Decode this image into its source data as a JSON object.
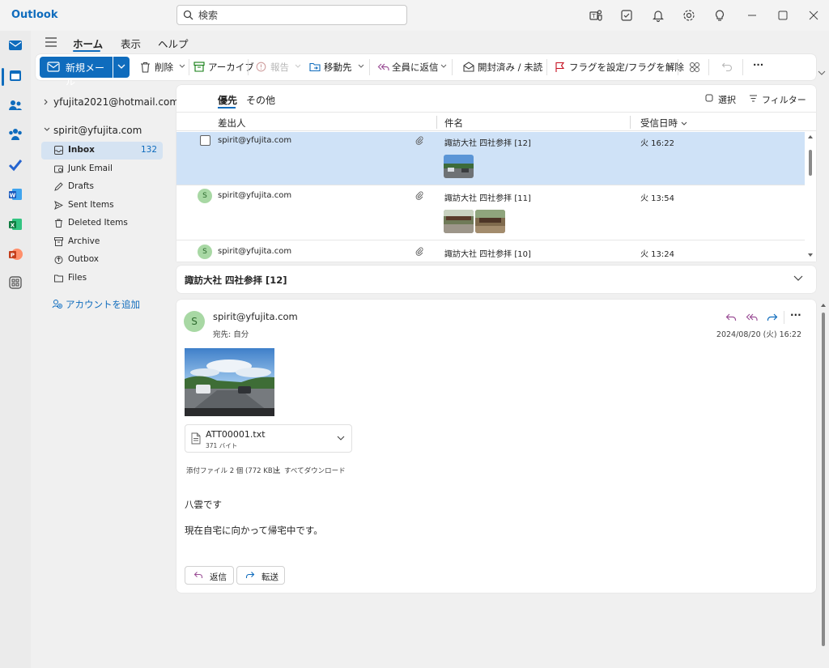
{
  "app": {
    "title": "Outlook"
  },
  "search": {
    "placeholder": "検索"
  },
  "ribbon_tabs": {
    "home": "ホーム",
    "view": "表示",
    "help": "ヘルプ"
  },
  "ribbon": {
    "new_mail": "新規メール",
    "delete": "削除",
    "archive": "アーカイブ",
    "report": "報告",
    "move_to": "移動先",
    "reply_all": "全員に返信",
    "read_unread": "開封済み / 未読",
    "flag": "フラグを設定/フラグを解除",
    "more": "···"
  },
  "folders": {
    "account1": "yfujita2021@hotmail.com",
    "account2": "spirit@yfujita.com",
    "items": [
      {
        "label": "Inbox",
        "count": "132"
      },
      {
        "label": "Junk Email"
      },
      {
        "label": "Drafts"
      },
      {
        "label": "Sent Items"
      },
      {
        "label": "Deleted Items"
      },
      {
        "label": "Archive"
      },
      {
        "label": "Outbox"
      },
      {
        "label": "Files"
      }
    ],
    "add_account": "アカウントを追加"
  },
  "list": {
    "tab_focused": "優先",
    "tab_other": "その他",
    "select": "選択",
    "filter": "フィルター",
    "col_from": "差出人",
    "col_subject": "件名",
    "col_received": "受信日時",
    "rows": [
      {
        "sender": "spirit@yfujita.com",
        "subject": "諏訪大社 四社参拝 [12]",
        "date": "火 16:22"
      },
      {
        "sender": "spirit@yfujita.com",
        "subject": "諏訪大社 四社参拝 [11]",
        "date": "火 13:54"
      },
      {
        "sender": "spirit@yfujita.com",
        "subject": "諏訪大社 四社参拝 [10]",
        "date": "火 13:24"
      }
    ]
  },
  "conversation": {
    "title": "諏訪大社 四社参拝 [12]"
  },
  "message": {
    "avatar": "S",
    "from": "spirit@yfujita.com",
    "to": "宛先: 自分",
    "date": "2024/08/20 (火) 16:22",
    "attachment": {
      "name": "ATT00001.txt",
      "size": "371 バイト"
    },
    "attachment_summary": "添付ファイル 2 個 (772 KB)",
    "download_all": "すべてダウンロード",
    "body": [
      "八雲です",
      "現在自宅に向かって帰宅中です。"
    ],
    "reply": "返信",
    "forward": "転送"
  },
  "colors": {
    "accent": "#0f6cbd",
    "selected_row": "#cfe2f7",
    "avatar_bg": "#a8d8a4"
  }
}
